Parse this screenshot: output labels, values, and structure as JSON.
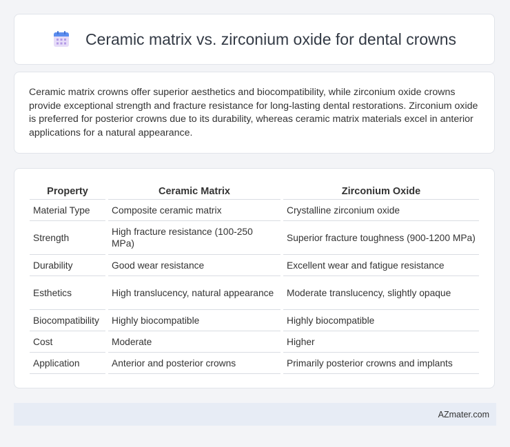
{
  "header": {
    "title": "Ceramic matrix vs. zirconium oxide for dental crowns",
    "icon": "calendar-icon"
  },
  "summary": {
    "text": "Ceramic matrix crowns offer superior aesthetics and biocompatibility, while zirconium oxide crowns provide exceptional strength and fracture resistance for long-lasting dental restorations. Zirconium oxide is preferred for posterior crowns due to its durability, whereas ceramic matrix materials excel in anterior applications for a natural appearance."
  },
  "table": {
    "headers": [
      "Property",
      "Ceramic Matrix",
      "Zirconium Oxide"
    ],
    "rows": [
      [
        "Material Type",
        "Composite ceramic matrix",
        "Crystalline zirconium oxide"
      ],
      [
        "Strength",
        "High fracture resistance (100-250 MPa)",
        "Superior fracture toughness (900-1200 MPa)"
      ],
      [
        "Durability",
        "Good wear resistance",
        "Excellent wear and fatigue resistance"
      ],
      [
        "Esthetics",
        "High translucency, natural appearance",
        "Moderate translucency, slightly opaque"
      ],
      [
        "Biocompatibility",
        "Highly biocompatible",
        "Highly biocompatible"
      ],
      [
        "Cost",
        "Moderate",
        "Higher"
      ],
      [
        "Application",
        "Anterior and posterior crowns",
        "Primarily posterior crowns and implants"
      ]
    ]
  },
  "footer": {
    "text": "AZmater.com"
  },
  "colors": {
    "background": "#f3f4f7",
    "card": "#ffffff",
    "footer": "#e7ecf5",
    "icon_top": "#5b8def",
    "icon_body": "#d9c8f5"
  }
}
